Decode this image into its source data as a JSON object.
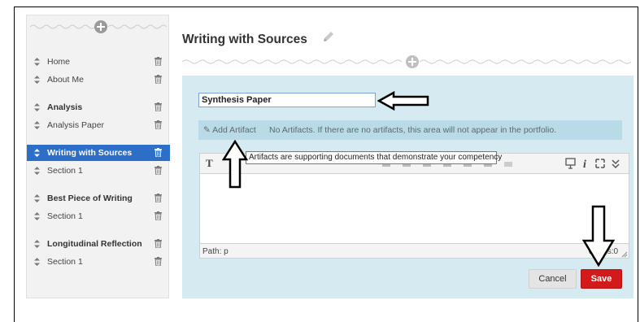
{
  "page": {
    "title": "Writing with Sources"
  },
  "sidebar": {
    "items": [
      {
        "label": "Home",
        "bold": false,
        "active": false
      },
      {
        "label": "About Me",
        "bold": false,
        "active": false
      },
      {
        "label": "Analysis",
        "bold": true,
        "active": false
      },
      {
        "label": "Analysis Paper",
        "bold": false,
        "active": false
      },
      {
        "label": "Writing with Sources",
        "bold": true,
        "active": true
      },
      {
        "label": "Section 1",
        "bold": false,
        "active": false
      },
      {
        "label": "Best Piece of Writing",
        "bold": true,
        "active": false
      },
      {
        "label": "Section 1",
        "bold": false,
        "active": false
      },
      {
        "label": "Longitudinal Reflection",
        "bold": true,
        "active": false
      },
      {
        "label": "Section 1",
        "bold": false,
        "active": false
      }
    ]
  },
  "editor": {
    "title_value": "Synthesis Paper",
    "add_artifact_label": "Add Artifact",
    "artifact_note": "No Artifacts. If there are no artifacts, this area will not appear in the portfolio.",
    "tooltip": "Artifacts are supporting documents that demonstrate your competency",
    "toolbar_text_icon": "T",
    "path_label": "Path: p",
    "words_label": "Words:0"
  },
  "actions": {
    "cancel_label": "Cancel",
    "save_label": "Save"
  },
  "colors": {
    "active_item": "#2d6ec9",
    "panel_bg": "#d5eaf1",
    "artifact_bar": "#b9dbe7",
    "save_button": "#d21a1a"
  },
  "icons": [
    "add-section-icon",
    "drag-handle-icon",
    "trash-icon",
    "pencil-icon",
    "paperclip-icon",
    "text-format-icon",
    "preview-icon",
    "info-icon",
    "fullscreen-icon",
    "expand-icon",
    "resize-handle-icon"
  ]
}
